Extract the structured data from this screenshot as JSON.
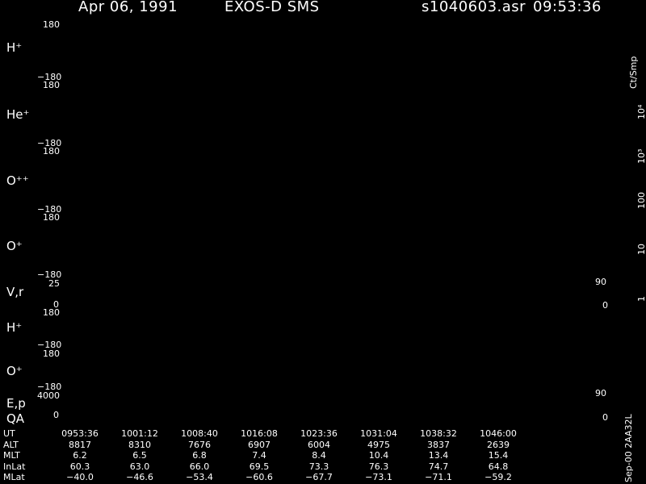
{
  "header": {
    "date": "Apr 06, 1991",
    "mission": "EXOS-D SMS",
    "file": "s1040603.asr",
    "time": "09:53:36"
  },
  "colorbar": {
    "unit": "Ct/Smp",
    "ticks": [
      "1",
      "10",
      "100",
      "10³",
      "10⁴"
    ]
  },
  "footer_tag": "Sep-00  2AA32L",
  "chart_data": [
    {
      "type": "heatmap",
      "panel": "H⁺",
      "y_ticks": [
        "180",
        "−180"
      ],
      "ylim": [
        -180,
        180
      ],
      "color_scale": "log",
      "color_range": [
        1,
        10000
      ]
    },
    {
      "type": "heatmap",
      "panel": "He⁺",
      "y_ticks": [
        "180",
        "−180"
      ],
      "ylim": [
        -180,
        180
      ],
      "color_scale": "log",
      "color_range": [
        1,
        10000
      ]
    },
    {
      "type": "heatmap",
      "panel": "O⁺⁺",
      "y_ticks": [
        "180",
        "−180"
      ],
      "ylim": [
        -180,
        180
      ],
      "color_scale": "log",
      "color_range": [
        1,
        10000
      ]
    },
    {
      "type": "heatmap",
      "panel": "O⁺",
      "y_ticks": [
        "180",
        "−180"
      ],
      "ylim": [
        -180,
        180
      ],
      "color_scale": "log",
      "color_range": [
        1,
        10000
      ]
    },
    {
      "type": "line",
      "panel": "V,r",
      "y_ticks": [
        "25",
        "0"
      ],
      "right_ticks": [
        "90",
        "0"
      ]
    },
    {
      "type": "heatmap",
      "panel": "H⁺",
      "y_ticks": [
        "180",
        "−180"
      ],
      "ylim": [
        -180,
        180
      ]
    },
    {
      "type": "heatmap",
      "panel": "O⁺",
      "y_ticks": [
        "180",
        "−180"
      ],
      "ylim": [
        -180,
        180
      ]
    },
    {
      "type": "line",
      "panel": "E,p",
      "panel2": "QA",
      "y_ticks": [
        "4000",
        "0"
      ],
      "right_ticks": [
        "90",
        "0"
      ]
    },
    {
      "type": "table",
      "rows": [
        {
          "name": "UT",
          "values": [
            "0953:36",
            "1001:12",
            "1008:40",
            "1016:08",
            "1023:36",
            "1031:04",
            "1038:32",
            "1046:00"
          ]
        },
        {
          "name": "ALT",
          "values": [
            "8817",
            "8310",
            "7676",
            "6907",
            "6004",
            "4975",
            "3837",
            "2639"
          ]
        },
        {
          "name": "MLT",
          "values": [
            "6.2",
            "6.5",
            "6.8",
            "7.4",
            "8.4",
            "10.4",
            "13.4",
            "15.4"
          ]
        },
        {
          "name": "InLat",
          "values": [
            "60.3",
            "63.0",
            "66.0",
            "69.5",
            "73.3",
            "76.3",
            "74.7",
            "64.8"
          ]
        },
        {
          "name": "MLat",
          "values": [
            "−40.0",
            "−46.6",
            "−53.4",
            "−60.6",
            "−67.7",
            "−73.1",
            "−71.1",
            "−59.2"
          ]
        }
      ]
    }
  ]
}
